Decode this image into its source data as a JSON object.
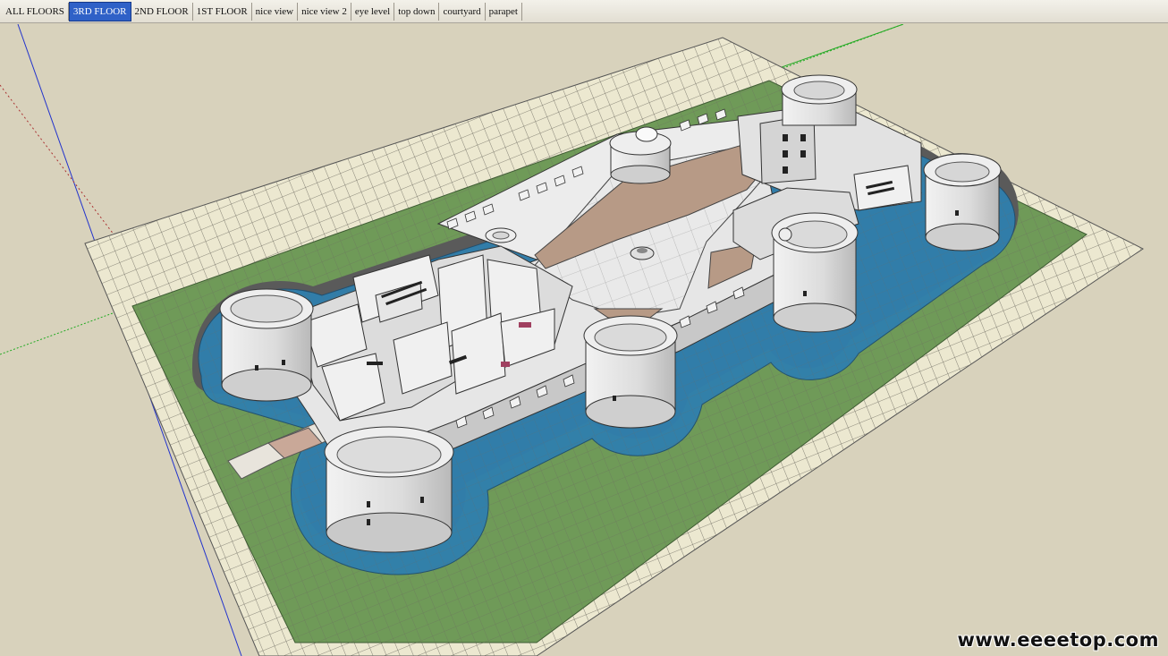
{
  "scene_tabs": [
    {
      "label": "ALL FLOORS"
    },
    {
      "label": "3RD FLOOR"
    },
    {
      "label": "2ND FLOOR"
    },
    {
      "label": "1ST FLOOR"
    },
    {
      "label": "nice view"
    },
    {
      "label": "nice view 2"
    },
    {
      "label": "eye level"
    },
    {
      "label": "top down"
    },
    {
      "label": "courtyard"
    },
    {
      "label": "parapet"
    }
  ],
  "active_tab": "3RD FLOOR",
  "watermark": "www.eeeetop.com",
  "colors": {
    "background": "#d8d2bc",
    "tab_active": "#2f61c7",
    "ground_outer": "#ece8d0",
    "grass": "#6f9a58",
    "moat": "#2f7fae",
    "moat_shadow": "#5a5a5a",
    "stone": "#e4e4e4",
    "courtyard_floor": "#b79a86",
    "axis_blue": "#2233cc",
    "axis_green": "#22aa22",
    "axis_red": "#aa3333"
  }
}
